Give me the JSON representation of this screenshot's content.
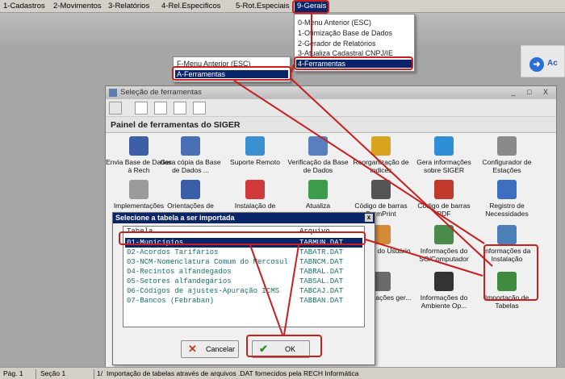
{
  "menubar": {
    "items": [
      "1-Cadastros",
      "2-Movimentos",
      "3-Relatórios",
      "4-Rel.Especificos",
      "5-Rot.Especiais",
      "9-Gerais"
    ]
  },
  "right_panel": {
    "text": "Ac"
  },
  "gerais_menu": {
    "items": [
      "0-Menu Anterior (ESC)",
      "1-Otimização Base de Dados",
      "2-Gerador de Relatórios",
      "3-Atualiza Cadastral CNPJ/IE",
      "4-Ferramentas"
    ],
    "selected_index": 4
  },
  "sub_menu": {
    "items": [
      "F-Menu Anterior (ESC)",
      "A-Ferramentas"
    ],
    "selected_index": 1
  },
  "tools_window": {
    "title": "Seleção de ferramentas",
    "panel_title": "Painel de ferramentas do SIGER",
    "controls": "_ □ X"
  },
  "tools": [
    {
      "label": "Envia Base de Dados à Rech",
      "icon": "database-send-icon",
      "color": "#3d5fa8"
    },
    {
      "label": "Gera cópia da Base de Dados ...",
      "icon": "database-copy-icon",
      "color": "#4b6fb5"
    },
    {
      "label": "Suporte Remoto",
      "icon": "remote-support-icon",
      "color": "#3a8fd0"
    },
    {
      "label": "Verificação da Base de Dados",
      "icon": "database-check-icon",
      "color": "#5a7fc0"
    },
    {
      "label": "Reorganização de índices",
      "icon": "index-reorganize-icon",
      "color": "#d9a420"
    },
    {
      "label": "Gera informações sobre SIGER",
      "icon": "info-gears-icon",
      "color": "#2f8ed8"
    },
    {
      "label": "Configurador de Estações",
      "icon": "workstation-config-icon",
      "color": "#8a8a8a"
    },
    {
      "label": "Implementações",
      "icon": "document-scroll-icon",
      "color": "#9a9a9a"
    },
    {
      "label": "Orientações de",
      "icon": "guide-book-icon",
      "color": "#3a5fa8"
    },
    {
      "label": "Instalação de",
      "icon": "install-error-icon",
      "color": "#d23a3a"
    },
    {
      "label": "Atualiza",
      "icon": "update-globe-icon",
      "color": "#3c9c4a"
    },
    {
      "label": "Código de barras FormPrint",
      "icon": "barcode-icon",
      "color": "#555555"
    },
    {
      "label": "Código de barras PDF",
      "icon": "pdf-icon",
      "color": "#c0392b"
    },
    {
      "label": "Registro de Necessidades",
      "icon": "tools-wrench-icon",
      "color": "#3d6fc0"
    },
    {
      "label": "mações do Usuário",
      "icon": "users-icon",
      "color": "#d58a3a"
    },
    {
      "label": "Informações do SO/Computador",
      "icon": "computer-info-icon",
      "color": "#4a8a4a"
    },
    {
      "label": "Informações da Instalação",
      "icon": "install-info-icon",
      "color": "#4a7fb8"
    },
    {
      "label": "mprime ações ger...",
      "icon": "printer-icon",
      "color": "#6a6a6a"
    },
    {
      "label": "Informações do Ambiente Op...",
      "icon": "linux-penguin-icon",
      "color": "#333333"
    },
    {
      "label": "Importação de Tabelas",
      "icon": "table-import-icon",
      "color": "#3f8c3f"
    }
  ],
  "import_dialog": {
    "title": "Selecione a tabela a ser importada",
    "close": "x",
    "columns": [
      "Tabela",
      "Arquivo"
    ],
    "rows": [
      {
        "tabela": "01-Municípios",
        "arquivo": "TABMUN.DAT"
      },
      {
        "tabela": "02-Acordos Tarifários",
        "arquivo": "TABATR.DAT"
      },
      {
        "tabela": "03-NCM-Nomenclatura Comum do Mercosul",
        "arquivo": "TABNCM.DAT"
      },
      {
        "tabela": "04-Recintos alfandegados",
        "arquivo": "TABRAL.DAT"
      },
      {
        "tabela": "05-Setores alfandegários",
        "arquivo": "TABSAL.DAT"
      },
      {
        "tabela": "06-Códigos de ajustes-Apuração ICMS",
        "arquivo": "TABCAJ.DAT"
      },
      {
        "tabela": "07-Bancos (Febraban)",
        "arquivo": "TABBAN.DAT"
      }
    ],
    "selected_index": 0,
    "cancel_label": "Cancelar",
    "ok_label": "OK"
  },
  "statusbar": {
    "page": "Pág. 1",
    "section": "Seção 1",
    "col": "1/",
    "message": "Importação de tabelas através de arquivos .DAT fornecidos pela RECH Informática"
  },
  "colors": {
    "highlight": "#c81e1e",
    "selection": "#0a246a"
  }
}
